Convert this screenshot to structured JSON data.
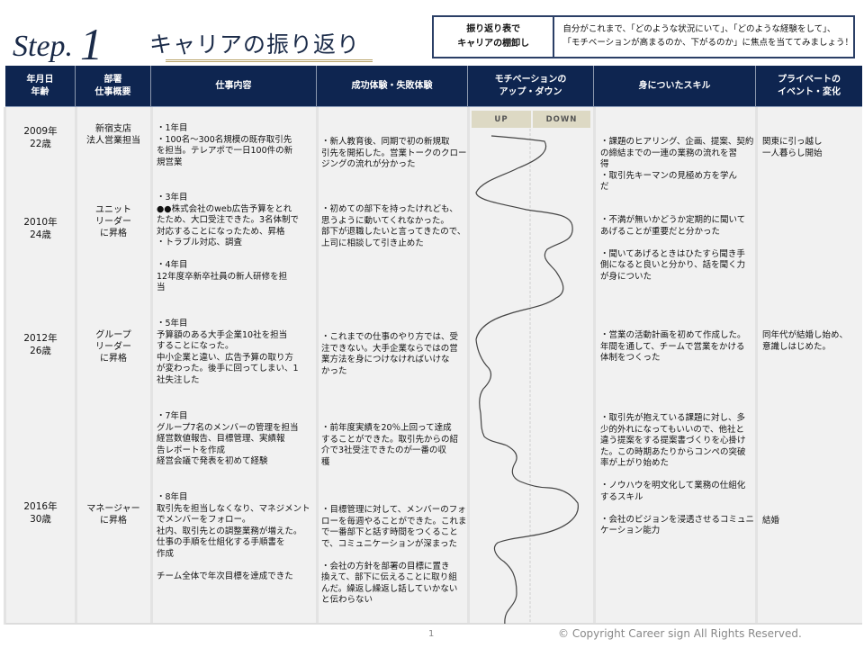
{
  "header": {
    "step_label": "Step.",
    "step_number": "1",
    "subtitle": "キャリアの振り返り"
  },
  "info_box": {
    "label": "振り返り表で\nキャリアの棚卸し",
    "text": "自分がこれまで、「どのような状況にいて」、「どのような経験をして」、\n「モチベーションが高まるのか、下がるのか」に焦点を当ててみましょう！"
  },
  "table": {
    "columns": [
      "年月日\n年齢",
      "部署\n仕事概要",
      "仕事内容",
      "成功体験・失敗体験",
      "モチベーションの\nアップ・ダウン",
      "身についたスキル",
      "プライベートの\nイベント・変化"
    ],
    "motivation_labels": {
      "up": "UP",
      "down": "DOWN"
    },
    "rows": [
      {
        "date": "2009年\n22歳",
        "dept": "新宿支店\n法人営業担当"
      },
      {
        "date": "2010年\n24歳",
        "dept": "ユニット\nリーダー\nに昇格"
      },
      {
        "date": "2012年\n26歳",
        "dept": "グループ\nリーダー\nに昇格"
      },
      {
        "date": "2016年\n30歳",
        "dept": "マネージャー\nに昇格"
      }
    ],
    "work_content": [
      "・1年目\n・100名～300名規模の既存取引先\nを担当。テレアポで一日100件の新\n規営業",
      "・3年目\n●●株式会社のweb広告予算をとれ\nたため、大口受注できた。3名体制で\n対応することになったため、昇格\n・トラブル対応、調査\n\n・4年目\n12年度卒新卒社員の新人研修を担\n当",
      "・5年目\n予算額のある大手企業10社を担当\nすることになった。\n中小企業と違い、広告予算の取り方\nが変わった。後手に回ってしまい、1\n社失注した",
      "・7年目\nグループ7名のメンバーの管理を担当\n経営数値報告、目標管理、実績報\n告レポートを作成\n経営会議で発表を初めて経験",
      "・8年目\n取引先を担当しなくなり、マネジメント\nでメンバーをフォロー。\n社内、取引先との調整業務が増えた。\n仕事の手順を仕組化する手順書を\n作成\n\nチーム全体で年次目標を達成できた"
    ],
    "success_failure": [
      "・新人教育後、同期で初の新規取\n引先を開拓した。営業トークのクロー\nジングの流れが分かった",
      "・初めての部下を持ったけれども、\n思うように動いてくれなかった。\n部下が退職したいと言ってきたので、\n上司に相談して引き止めた",
      "・これまでの仕事のやり方では、受\n注できない。大手企業ならではの営\n業方法を身につけなければいけな\nかった",
      "・前年度実績を20％上回って達成\nすることができた。取引先からの紹\n介で3社受注できたのが一番の収\n穫",
      "・目標管理に対して、メンバーのフォ\nローを毎週やることができた。これま\nで一番部下と話す時間をつくること\nで、コミュニケーションが深まった\n\n・会社の方針を部署の目標に置き\n換えて、部下に伝えることに取り組\nんだ。繰返し繰返し話していかない\nと伝わらない"
    ],
    "skills": [
      "・課題のヒアリング、企画、提案、契約\nの締結までの一連の業務の流れを習\n得\n・取引先キーマンの見極め方を学ん\nだ",
      "・不満が無いかどうか定期的に聞いて\nあげることが重要だと分かった\n\n・聞いてあげるときはひたすら聞き手\n側になると良いと分かり、話を聞く力\nが身についた",
      "・営業の活動計画を初めて作成した。\n年間を通して、チームで営業をかける\n体制をつくった",
      "・取引先が抱えている課題に対し、多\n少的外れになってもいいので、他社と\n違う提案をする提案書づくりを心掛け\nた。この時期あたりからコンペの突破\n率が上がり始めた\n\n・ノウハウを明文化して業務の仕組化\nするスキル\n\n・会社のビジョンを浸透させるコミュニ\nケーション能力"
    ],
    "private_events": [
      "関東に引っ越し\n一人暮らし開始",
      "同年代が結婚し始め、\n意識しはじめた。",
      "結婚"
    ]
  },
  "footer": {
    "page_number": "1",
    "copyright": "© Copyright  Career sign All Rights Reserved."
  }
}
